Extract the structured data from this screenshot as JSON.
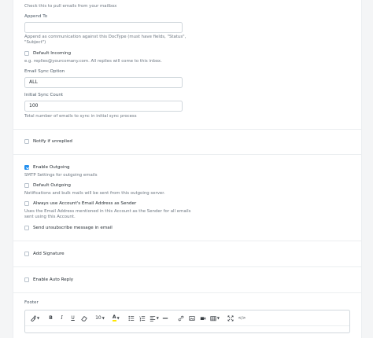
{
  "mailbox_help": "Check this to pull emails from your mailbox",
  "append_to": {
    "label": "Append To",
    "value": "",
    "help": "Append as communication against this DocType (must have fields, \"Status\", \"Subject\")"
  },
  "default_incoming": {
    "label": "Default Incoming",
    "checked": false,
    "help": "e.g. replies@yourcomany.com. All replies will come to this inbox."
  },
  "email_sync_option": {
    "label": "Email Sync Option",
    "value": "ALL"
  },
  "initial_sync_count": {
    "label": "Initial Sync Count",
    "value": "100",
    "help": "Total number of emails to sync in initial sync process"
  },
  "notify_if_unreplied": {
    "label": "Notify if unreplied",
    "checked": false
  },
  "enable_outgoing": {
    "label": "Enable Outgoing",
    "checked": true,
    "help": "SMTP Settings for outgoing emails"
  },
  "default_outgoing": {
    "label": "Default Outgoing",
    "checked": false,
    "help": "Notifications and bulk mails will be sent from this outgoing server."
  },
  "always_use_account_email": {
    "label": "Always use Account's Email Address as Sender",
    "checked": false,
    "help_line1": "Uses the Email Address mentioned in this Account as the Sender for all emails",
    "help_line2": "sent using this Account."
  },
  "send_unsubscribe": {
    "label": "Send unsubscribe message in email",
    "checked": false
  },
  "add_signature": {
    "label": "Add Signature",
    "checked": false
  },
  "enable_auto_reply": {
    "label": "Enable Auto Reply",
    "checked": false
  },
  "footer": {
    "label": "Footer",
    "toolbar": {
      "font_size": "10",
      "bold": "B",
      "italic": "I",
      "underline": "U",
      "font_color": "A",
      "code_label": "</>"
    }
  },
  "colors": {
    "accent": "#2490ef",
    "highlight": "#ffe600"
  }
}
